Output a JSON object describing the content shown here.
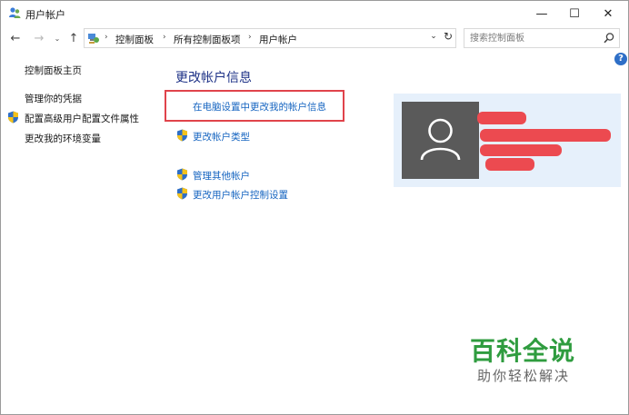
{
  "window": {
    "title": "用户帐户",
    "controls": {
      "minimize": "—",
      "maximize": "☐",
      "close": "✕"
    }
  },
  "nav": {
    "back": "←",
    "forward": "→",
    "recent": "⌄",
    "up": "↑",
    "breadcrumb": [
      "控制面板",
      "所有控制面板项",
      "用户帐户"
    ],
    "separator": "›",
    "dropdown": "⌄",
    "refresh": "↻",
    "search_placeholder": "搜索控制面板"
  },
  "help": "?",
  "sidebar": {
    "home": "控制面板主页",
    "links": [
      {
        "label": "管理你的凭据",
        "shield": false
      },
      {
        "label": "配置高级用户配置文件属性",
        "shield": true
      },
      {
        "label": "更改我的环境变量",
        "shield": false
      }
    ]
  },
  "main": {
    "title": "更改帐户信息",
    "highlighted_link": "在电脑设置中更改我的帐户信息",
    "links": [
      {
        "label": "更改帐户类型",
        "shield": true
      },
      {
        "label": "管理其他帐户",
        "shield": true
      },
      {
        "label": "更改用户帐户控制设置",
        "shield": true
      }
    ]
  },
  "watermark": {
    "title": "百科全说",
    "subtitle": "助你轻松解决"
  },
  "colors": {
    "link": "#1564c0",
    "section_title": "#1e3287",
    "highlight_border": "#e0434b",
    "redaction": "#ec4a50",
    "watermark_green": "#2f9c3f",
    "card_bg": "#e6f0fb",
    "avatar_bg": "#5a5a5a"
  },
  "icons": {
    "app": "user-accounts-icon",
    "shield": "uac-shield-icon",
    "search": "magnifier-icon",
    "avatar": "default-user-silhouette-icon"
  }
}
